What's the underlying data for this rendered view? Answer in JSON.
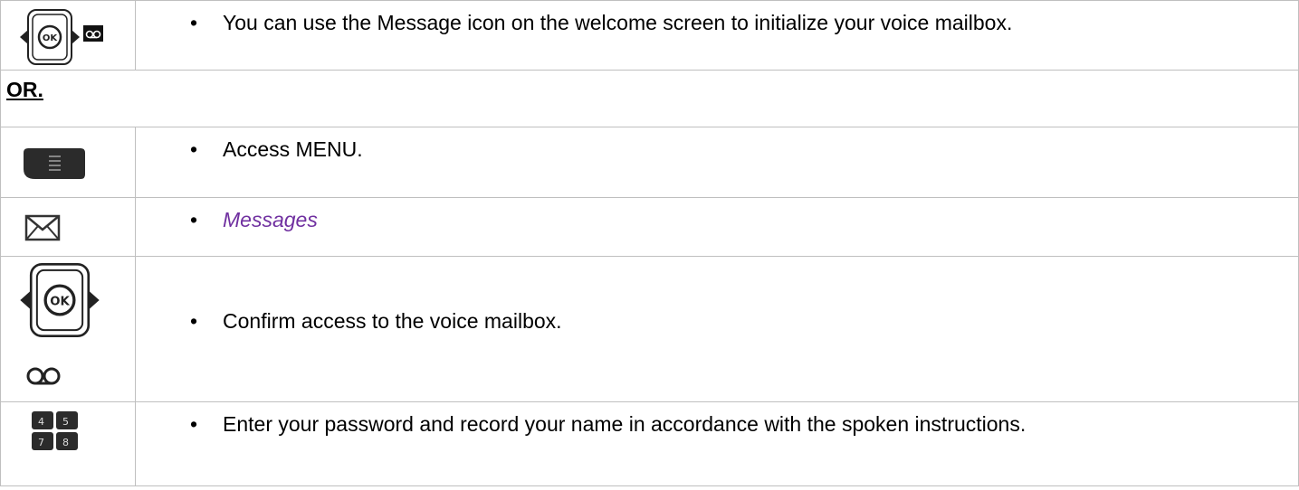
{
  "steps": [
    {
      "text": "You can use the Message icon on the welcome screen to initialize your voice mailbox.",
      "icons": [
        "ok-navigation-key-icon",
        "voicemail-icon"
      ]
    },
    {
      "or_label": "OR."
    },
    {
      "text": "Access MENU.",
      "icons": [
        "menu-key-icon"
      ]
    },
    {
      "text": "Messages",
      "icons": [
        "envelope-icon"
      ]
    },
    {
      "text": "Confirm access to the voice mailbox.",
      "icons": [
        "ok-navigation-key-icon",
        "voicemail-icon"
      ]
    },
    {
      "text": "Enter your password and record your name in accordance with the spoken instructions.",
      "icons": [
        "keypad-icon"
      ]
    }
  ],
  "bullet": "•",
  "ok_label": "OK",
  "keypad_keys": [
    "4",
    "5",
    "7",
    "8"
  ],
  "colors": {
    "border": "#bfbfbf",
    "accent_text": "#7030a0",
    "key_dark": "#2b2b2b"
  }
}
